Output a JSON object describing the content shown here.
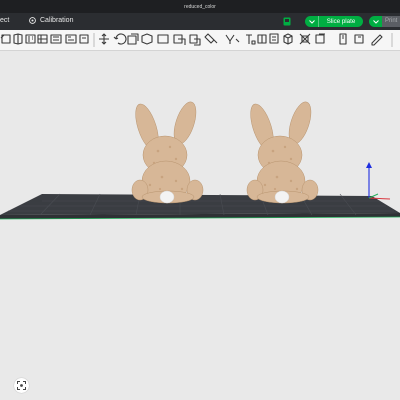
{
  "window": {
    "title": "reduced_color"
  },
  "tabs": {
    "project_label": "ect",
    "calibration_label": "Calibration"
  },
  "actions": {
    "slice_label": "Slice plate",
    "print_label": "Print"
  },
  "colors": {
    "accent": "#00ae42",
    "titlebar": "#1e1f22",
    "tabbar": "#2b2d31",
    "toolbar": "#f6f6f6",
    "viewport": "#e9e9e9",
    "plate": "#3a3d42",
    "model": "#d7b797",
    "axis_z": "#1e2ee0",
    "axis_x": "#d9363e",
    "axis_y": "#22b05a"
  },
  "toolbar": {
    "icons": [
      "add-icon",
      "add-plate-icon",
      "auto-orient-icon",
      "arrange-icon",
      "split-objects-icon",
      "split-parts-icon",
      "variable-layer-icon",
      "move-icon",
      "rotate-icon",
      "scale-icon",
      "place-on-face-icon",
      "cut-icon",
      "mesh-boolean-icon",
      "paint-support-icon",
      "seam-icon",
      "text-icon",
      "measure-icon",
      "assembly-icon",
      "color-paint-icon",
      "fuzzy-skin-icon",
      "mirror-icon",
      "layer-icon",
      "scissors-icon",
      "edit-icon"
    ]
  },
  "viewport": {
    "models": [
      "rabbit-model-left",
      "rabbit-model-right"
    ],
    "controls": [
      "fit-view-icon"
    ]
  }
}
